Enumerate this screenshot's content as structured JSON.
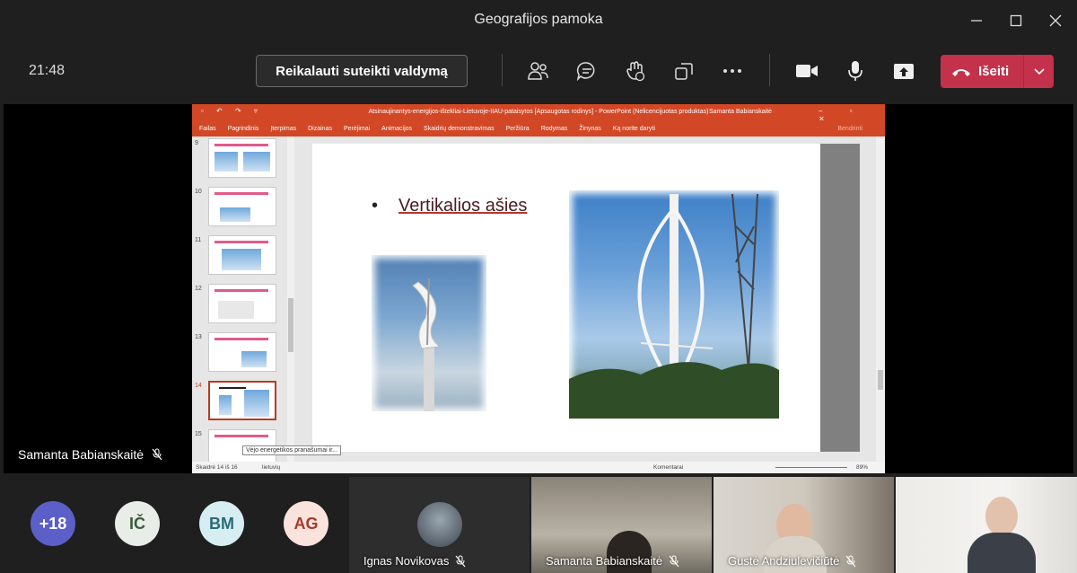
{
  "window": {
    "title": "Geografijos pamoka"
  },
  "toolbar": {
    "time": "21:48",
    "request_control_label": "Reikalauti suteikti valdymą",
    "leave_label": "Išeiti",
    "icons": [
      "people-icon",
      "chat-icon",
      "raise-hand-icon",
      "rooms-icon",
      "more-icon",
      "camera-icon",
      "microphone-icon",
      "share-icon"
    ]
  },
  "stage": {
    "presenter_name": "Samanta Babianskaitė"
  },
  "powerpoint": {
    "title": "Atsinaujinantys-energijos-ištekliai-Lietuvoje-IIAU-pataisytos [Apsaugotas rodinys]  -  PowerPoint (Nelicencijuotas produktas)",
    "user": "Samanta Babianskaitė",
    "ribbon_tabs": [
      "Failas",
      "Pagrindinis",
      "Įterpimas",
      "Dizainas",
      "Perėjimai",
      "Animacijos",
      "Skaidrių demonstravimas",
      "Peržiūra",
      "Rodymas",
      "Žinynas",
      "Ką norite daryti"
    ],
    "share": "Bendrinti",
    "thumbnails": [
      {
        "num": "9",
        "selected": false
      },
      {
        "num": "10",
        "selected": false
      },
      {
        "num": "11",
        "selected": false
      },
      {
        "num": "12",
        "selected": false
      },
      {
        "num": "13",
        "selected": false
      },
      {
        "num": "14",
        "selected": true
      },
      {
        "num": "15",
        "selected": false
      }
    ],
    "slide_heading": "Vertikalios ašies",
    "tooltip": "Vėjo energetikos pranašumai ir...",
    "status_slide": "Skaidrė 14 iš 16",
    "status_lang": "lietuvių",
    "status_notes": "Komentarai",
    "status_zoom": "89%",
    "colors": {
      "brand": "#d24726",
      "selected": "#b83b1e"
    }
  },
  "participants": {
    "overflow": "+18",
    "avatars": [
      {
        "initials": "IČ",
        "bg": "#e8ede8",
        "fg": "#3a5a3a"
      },
      {
        "initials": "BM",
        "bg": "#d6eef2",
        "fg": "#2a6a78"
      },
      {
        "initials": "AG",
        "bg": "#fbe3dd",
        "fg": "#a23b2a"
      }
    ],
    "tiles": [
      {
        "name": "Ignas Novikovas"
      },
      {
        "name": "Samanta Babianskaitė"
      },
      {
        "name": "Gustė Andziulevičiūtė"
      },
      {
        "name": ""
      }
    ]
  }
}
